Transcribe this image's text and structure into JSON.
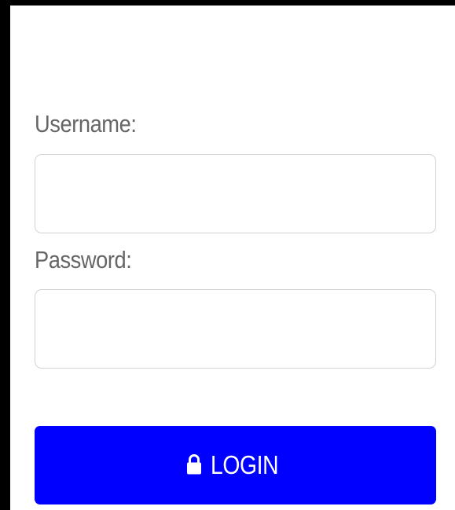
{
  "form": {
    "username_label": "Username:",
    "username_value": "",
    "username_placeholder": "",
    "password_label": "Password:",
    "password_value": "",
    "password_placeholder": "",
    "login_label": "LOGIN",
    "login_icon": "lock-icon"
  },
  "colors": {
    "page_background": "#000000",
    "panel_background": "#ffffff",
    "label_text": "#666666",
    "input_border": "#d2d2d2",
    "login_button": "#0000ff",
    "login_text": "#ffffff"
  }
}
